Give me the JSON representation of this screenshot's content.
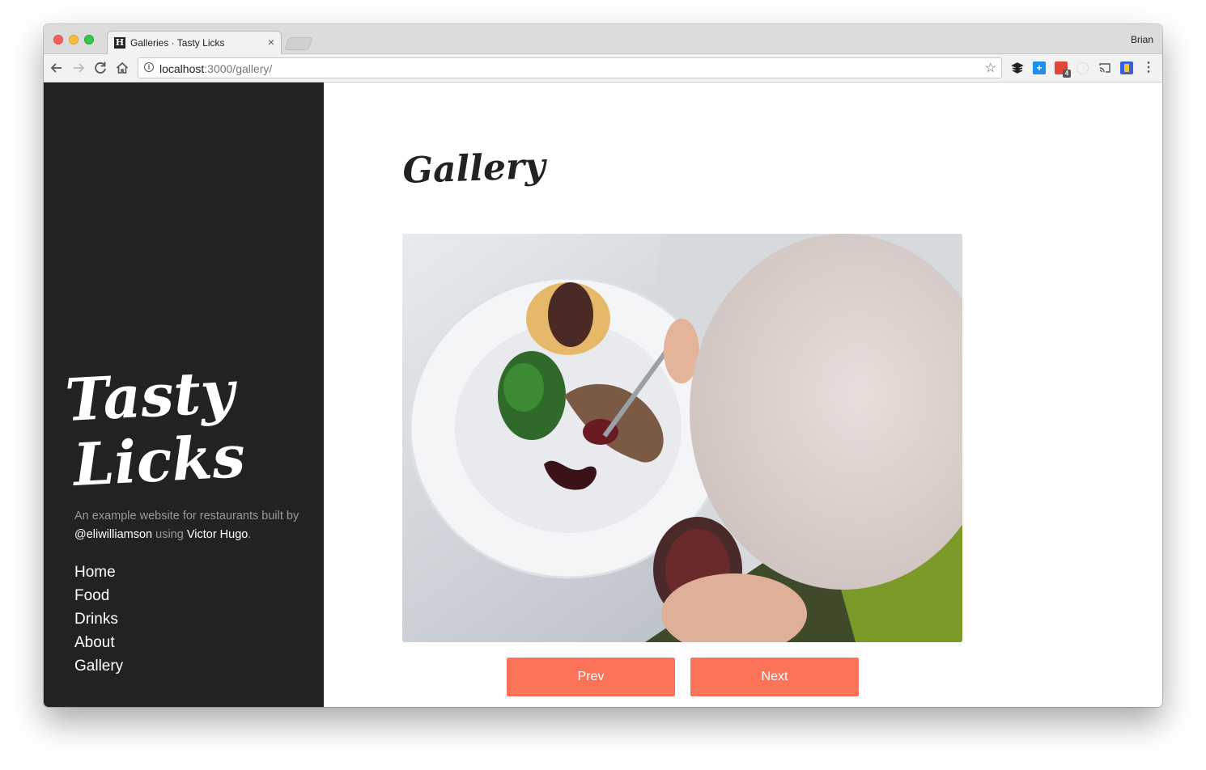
{
  "browser": {
    "tab_title": "Galleries · Tasty Licks",
    "tab_favicon_letter": "H",
    "tab_close_glyph": "×",
    "profile_name": "Brian",
    "url_host": "localhost",
    "url_path": ":3000/gallery/",
    "extension_badge": "4"
  },
  "sidebar": {
    "logo_line1": "Tasty",
    "logo_line2": "Licks",
    "tagline_pre": "An example website for restaurants built by ",
    "tagline_author": "@eliwilliamson",
    "tagline_mid": " using ",
    "tagline_tool": "Victor Hugo",
    "tagline_end": ".",
    "nav": [
      "Home",
      "Food",
      "Drinks",
      "About",
      "Gallery"
    ]
  },
  "main": {
    "heading": "Gallery",
    "prev_label": "Prev",
    "next_label": "Next"
  },
  "colors": {
    "sidebar_bg": "#222222",
    "button_bg": "#fd735a",
    "tagline_text": "#9a9a9a"
  },
  "icons": [
    "back-arrow-icon",
    "forward-arrow-icon",
    "reload-icon",
    "home-icon",
    "info-icon",
    "star-icon",
    "layers-icon",
    "plus-icon",
    "calendar-icon",
    "circle-icon",
    "cast-icon",
    "bookmark-icon",
    "menu-dots-icon"
  ]
}
